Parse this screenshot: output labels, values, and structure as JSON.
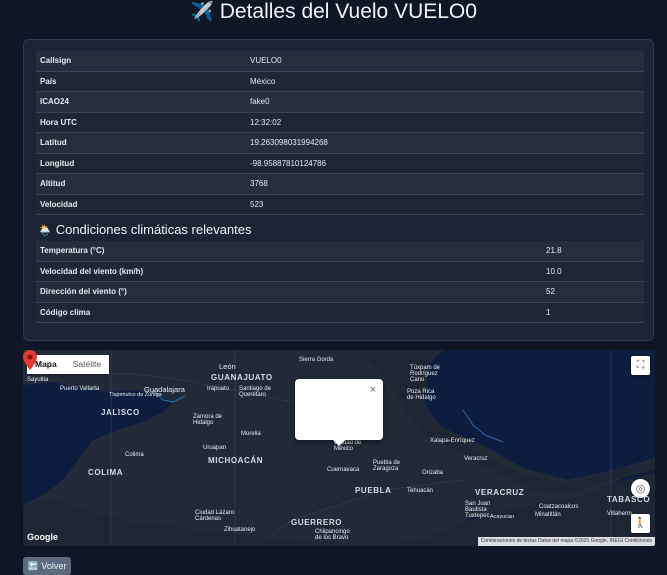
{
  "page": {
    "title_icon": "✈️",
    "title": "Detalles del Vuelo VUELO0"
  },
  "flight": {
    "rows": [
      {
        "label": "Callsign",
        "value": "VUELO0"
      },
      {
        "label": "País",
        "value": "México"
      },
      {
        "label": "ICAO24",
        "value": "fake0"
      },
      {
        "label": "Hora UTC",
        "value": "12:32:02"
      },
      {
        "label": "Latitud",
        "value": "19.263098031994268"
      },
      {
        "label": "Longitud",
        "value": "-98.95887810124786"
      },
      {
        "label": "Altitud",
        "value": "3768"
      },
      {
        "label": "Velocidad",
        "value": "523"
      }
    ]
  },
  "weather": {
    "icon": "🌦️",
    "heading": "Condiciones climáticas relevantes",
    "rows": [
      {
        "label": "Temperatura (°C)",
        "value": "21.8"
      },
      {
        "label": "Velocidad del viento (km/h)",
        "value": "10.0"
      },
      {
        "label": "Dirección del viento (°)",
        "value": "52"
      },
      {
        "label": "Código clima",
        "value": "1"
      }
    ]
  },
  "map": {
    "tab_map": "Mapa",
    "tab_satellite": "Satélite",
    "popup_close": "×",
    "logo": "Google",
    "attribution": "Combinaciones de teclas   Datos del mapa ©2025 Google, INEGI   Condiciones",
    "fullscreen_icon": "⛶",
    "locate_icon": "◎",
    "pegman_icon": "🚶",
    "labels": {
      "leon": "León",
      "guanajuato": "GUANAJUATO",
      "guadalajara": "Guadalajara",
      "jalisco": "JALISCO",
      "colima_state": "COLIMA",
      "colima": "Colima",
      "michoacan": "MICHOACÁN",
      "morelia": "Morelia",
      "uruapan": "Uruapan",
      "queretaro": "Santiago de Querétaro",
      "irapuato": "Irapuato",
      "sierra": "Sierra Gorda",
      "cdmx": "Ciudad de México",
      "cuernavaca": "Cuernavaca",
      "puebla_city": "Puebla de Zaragoza",
      "puebla": "PUEBLA",
      "guerrero": "GUERRERO",
      "chilpancingo": "Chilpancingo de los Bravo",
      "xalapa": "Xalapa-Enríquez",
      "veracruz_city": "Veracruz",
      "veracruz": "VERACRUZ",
      "tabasco": "TABASCO",
      "tuxpan": "Túxpam de Rodríguez Cano",
      "poza": "Poza Rica de Hidalgo",
      "orizaba": "Orizaba",
      "tehuacan": "Tehuacán",
      "coatzacoalcos": "Coatzacoalcos",
      "minatitlan": "Minatitlán",
      "villahermosa": "Villaherm",
      "zamora": "Zamora de Hidalgo",
      "lazaro": "Ciudad Lázaro Cárdenas",
      "zihuatanejo": "Zihuatanejo",
      "sayulita": "Sayulita",
      "vallarta": "Puerto Vallarta",
      "tlajomulco": "Tlajomulco de Zúñiga",
      "sanjuan": "San Juan Bautista Tuxtepec",
      "acayucan": "Acayucan"
    }
  },
  "actions": {
    "back_icon": "🔙",
    "back": "Volver"
  }
}
